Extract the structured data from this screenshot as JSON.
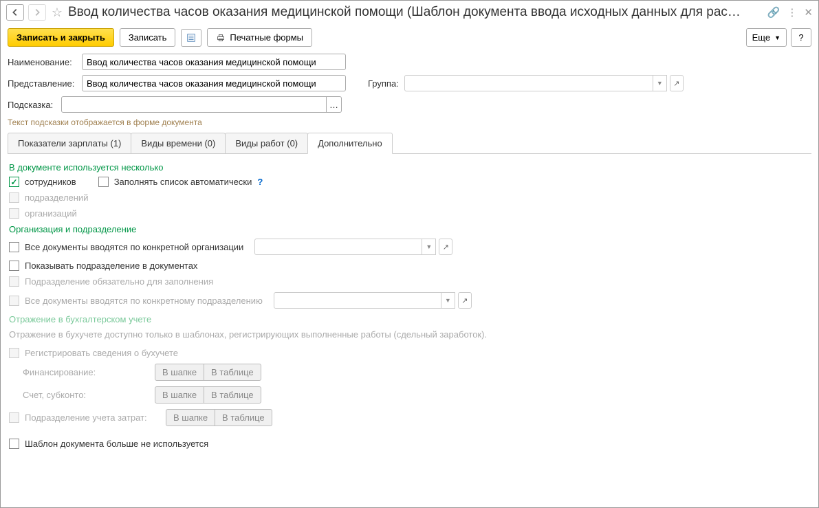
{
  "title": "Ввод количества часов оказания медицинской помощи (Шаблон документа ввода исходных данных для рас…",
  "toolbar": {
    "save_close": "Записать и закрыть",
    "save": "Записать",
    "print": "Печатные формы",
    "more": "Еще",
    "help": "?"
  },
  "form": {
    "name_label": "Наименование:",
    "name_value": "Ввод количества часов оказания медицинской помощи",
    "view_label": "Представление:",
    "view_value": "Ввод количества часов оказания медицинской помощи",
    "group_label": "Группа:",
    "group_value": "",
    "hint_label": "Подсказка:",
    "hint_value": "",
    "hint_info": "Текст подсказки отображается в форме документа"
  },
  "tabs": [
    "Показатели зарплаты (1)",
    "Виды времени (0)",
    "Виды работ (0)",
    "Дополнительно"
  ],
  "add": {
    "section1_title": "В документе используется несколько",
    "employees": "сотрудников",
    "autofill": "Заполнять список автоматически",
    "departments": "подразделений",
    "orgs": "организаций",
    "section2_title": "Организация и подразделение",
    "all_docs_org": "Все документы вводятся по конкретной организации",
    "show_dept": "Показывать подразделение в документах",
    "dept_required": "Подразделение обязательно для заполнения",
    "all_docs_dept": "Все документы вводятся по конкретному подразделению",
    "section3_title": "Отражение в бухгалтерском учете",
    "section3_info": "Отражение в бухучете доступно только в шаблонах, регистрирующих выполненные работы (сдельный заработок).",
    "register_accounting": "Регистрировать сведения о бухучете",
    "financing": "Финансирование:",
    "account": "Счет, субконто:",
    "dept_cost": "Подразделение учета затрат:",
    "in_header": "В шапке",
    "in_table": "В таблице",
    "not_used": "Шаблон документа больше не используется"
  }
}
